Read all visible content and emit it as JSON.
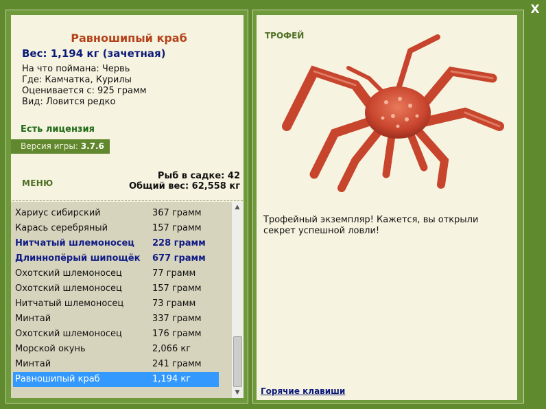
{
  "close_symbol": "X",
  "fish": {
    "title": "Равношипый краб",
    "weight": "Вес: 1,194 кг (зачетная)",
    "bait": "На что поймана: Червь",
    "location": "Где: Камчатка, Курилы",
    "valued": "Оценивается с: 925 грамм",
    "rarity": "Вид: Ловится редко"
  },
  "license": "Есть лицензия",
  "version": {
    "label": "Версия игры:",
    "value": "3.7.6"
  },
  "menu_label": "МЕНЮ",
  "keepnet": {
    "count": "Рыб в садке: 42",
    "total": "Общий вес: 62,558 кг"
  },
  "catch_list": [
    {
      "name": "Хариус сибирский",
      "weight": "367 грамм",
      "style": "normal"
    },
    {
      "name": "Карась серебряный",
      "weight": "157 грамм",
      "style": "normal"
    },
    {
      "name": "Нитчатый шлемоносец",
      "weight": "228 грамм",
      "style": "bold"
    },
    {
      "name": "Длиннопёрый шипощёк",
      "weight": "677 грамм",
      "style": "bold"
    },
    {
      "name": "Охотский шлемоносец",
      "weight": "77 грамм",
      "style": "normal"
    },
    {
      "name": "Охотский шлемоносец",
      "weight": "157 грамм",
      "style": "normal"
    },
    {
      "name": "Нитчатый шлемоносец",
      "weight": "73 грамм",
      "style": "normal"
    },
    {
      "name": "Минтай",
      "weight": "337 грамм",
      "style": "normal"
    },
    {
      "name": "Охотский шлемоносец",
      "weight": "176 грамм",
      "style": "normal"
    },
    {
      "name": "Морской окунь",
      "weight": "2,066 кг",
      "style": "normal"
    },
    {
      "name": "Минтай",
      "weight": "241 грамм",
      "style": "normal"
    },
    {
      "name": "Равношипый краб",
      "weight": "1,194 кг",
      "style": "selected"
    }
  ],
  "trophy": {
    "label": "ТРОФЕЙ",
    "text": "Трофейный экземпляр! Кажется, вы открыли секрет успешной ловли!"
  },
  "hotkeys": "Горячие клавиши",
  "scroll_icons": {
    "up": "▲",
    "down": "▼"
  }
}
